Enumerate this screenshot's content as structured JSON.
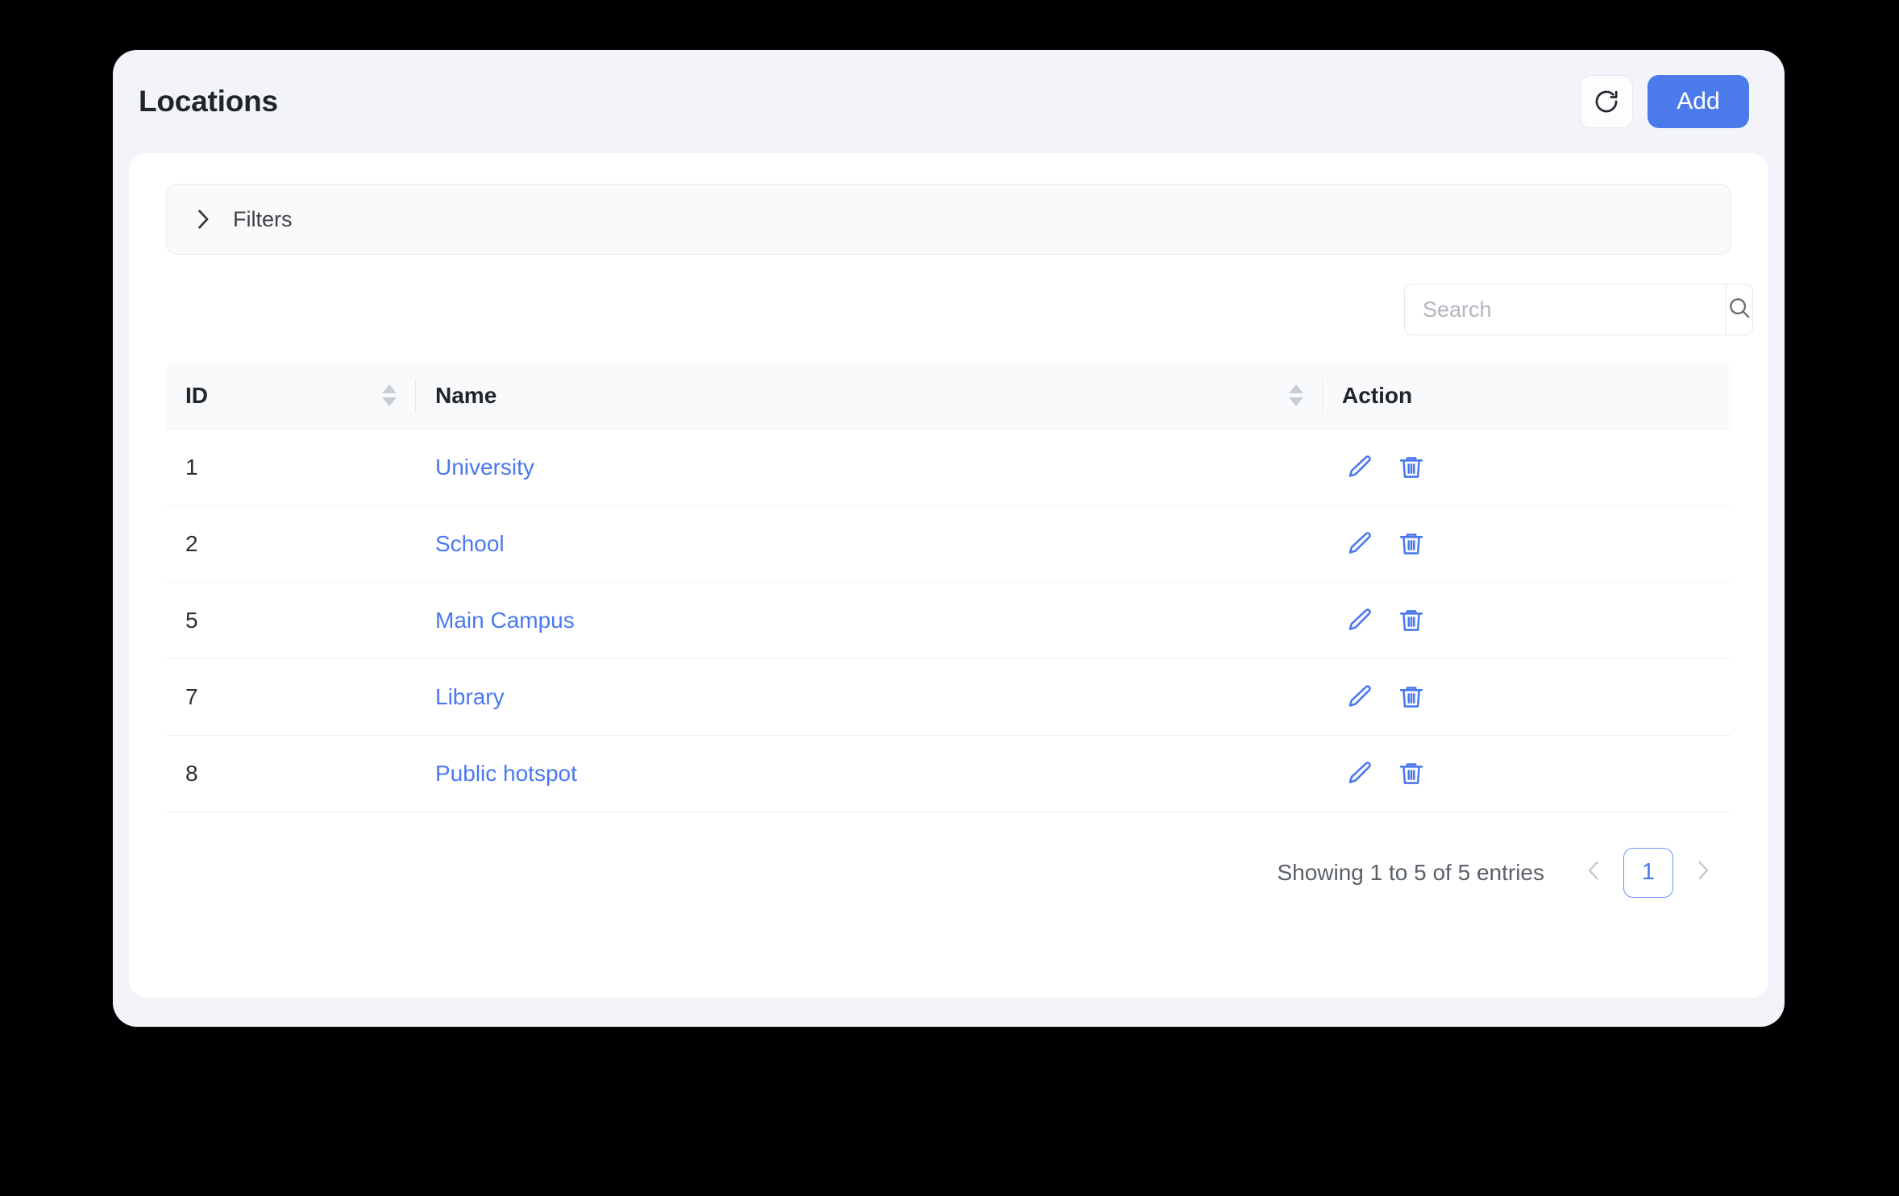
{
  "header": {
    "title": "Locations",
    "refresh_icon": "refresh-icon",
    "add_label": "Add"
  },
  "filters": {
    "label": "Filters",
    "chevron_icon": "chevron-right-icon",
    "expanded": false
  },
  "search": {
    "value": "",
    "placeholder": "Search",
    "button_icon": "search-icon"
  },
  "table": {
    "columns": [
      {
        "label": "ID",
        "sortable": true
      },
      {
        "label": "Name",
        "sortable": true
      },
      {
        "label": "Action",
        "sortable": false
      }
    ],
    "rows": [
      {
        "id": "1",
        "name": "University"
      },
      {
        "id": "2",
        "name": "School"
      },
      {
        "id": "5",
        "name": "Main Campus"
      },
      {
        "id": "7",
        "name": "Library"
      },
      {
        "id": "8",
        "name": "Public hotspot"
      }
    ],
    "row_actions": {
      "edit_icon": "pencil-icon",
      "delete_icon": "trash-icon"
    }
  },
  "footer": {
    "entries_info": "Showing 1 to 5 of 5 entries",
    "prev_icon": "chevron-left-icon",
    "next_icon": "chevron-right-icon",
    "pages": [
      "1"
    ],
    "active_page": "1"
  },
  "colors": {
    "accent": "#4b7beb",
    "link": "#4a78ef",
    "page_bg": "#f2f4f9",
    "card_bg": "#ffffff",
    "table_header_bg": "#f9fafb",
    "muted_text": "#5b6068"
  }
}
